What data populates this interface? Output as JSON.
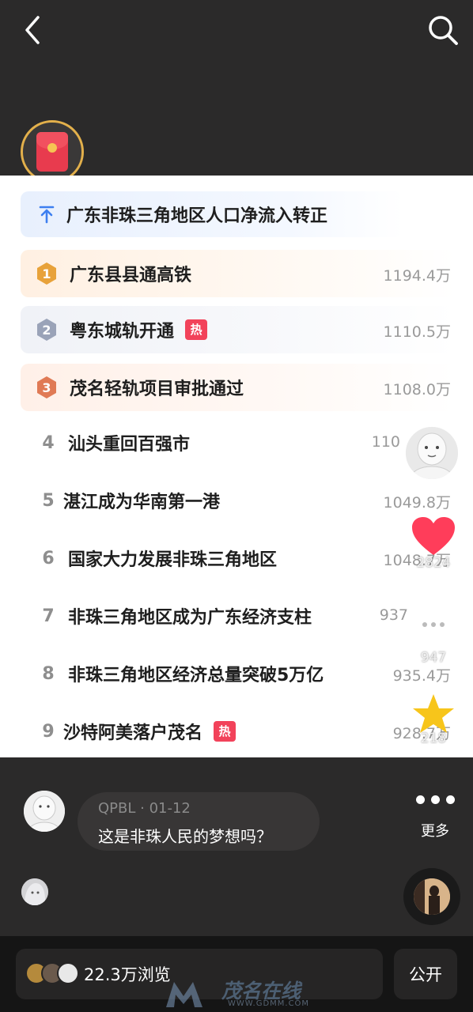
{
  "header": {
    "back_icon": "chevron-left-icon",
    "search_icon": "search-icon"
  },
  "red_packet": {
    "icon": "red-envelope-icon"
  },
  "hot_list": {
    "pinned": {
      "icon": "arrow-up-icon",
      "title": "广东非珠三角地区人口净流入转正"
    },
    "items": [
      {
        "rank": "1",
        "title": "广东县县通高铁",
        "count": "1194.4万",
        "hot": ""
      },
      {
        "rank": "2",
        "title": "粤东城轨开通",
        "count": "1110.5万",
        "hot": "热"
      },
      {
        "rank": "3",
        "title": "茂名轻轨项目审批通过",
        "count": "1108.0万",
        "hot": ""
      },
      {
        "rank": "4",
        "title": "汕头重回百强市",
        "count": "110",
        "hot": ""
      },
      {
        "rank": "5",
        "title": "湛江成为华南第一港",
        "count": "1049.8万",
        "hot": ""
      },
      {
        "rank": "6",
        "title": "国家大力发展非珠三角地区",
        "count": "1048.7万",
        "hot": ""
      },
      {
        "rank": "7",
        "title": "非珠三角地区成为广东经济支柱",
        "count": "937",
        "hot": ""
      },
      {
        "rank": "8",
        "title": "非珠三角地区经济总量突破5万亿",
        "count": "935.4万",
        "hot": ""
      },
      {
        "rank": "9",
        "title": "沙特阿美落户茂名",
        "count": "928.7万",
        "hot": "热"
      }
    ]
  },
  "side_actions": {
    "like_count": "2824",
    "comment_count": "947",
    "favorite_count": "218"
  },
  "comment": {
    "author": "QPBL · 01-12",
    "text": "这是非珠人民的梦想吗？"
  },
  "more": {
    "label": "更多"
  },
  "footer": {
    "views": "22.3万浏览",
    "public_label": "公开"
  },
  "watermark": {
    "text": "茂名在线",
    "url": "WWW.GDMM.COM"
  },
  "colors": {
    "hot_badge": "#f2425a",
    "gold": "#e8a23a",
    "silver": "#9aa3b8",
    "bronze": "#e07a55",
    "like": "#ff3d5a",
    "star": "#f7c51b"
  }
}
